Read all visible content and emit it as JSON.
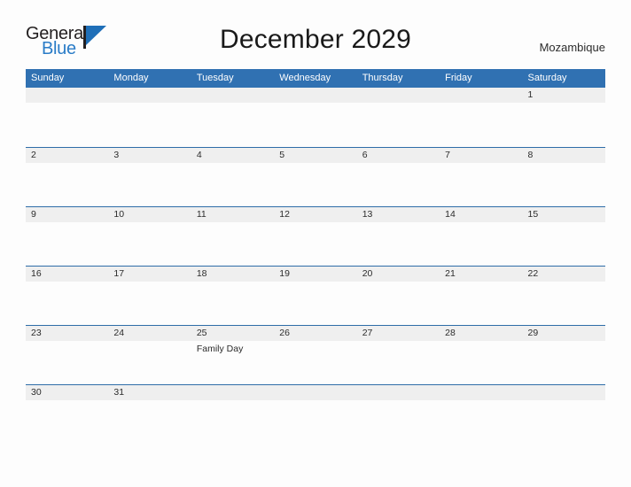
{
  "brand": {
    "name_part1": "General",
    "name_part2": "Blue",
    "mark": "pennant-triangle"
  },
  "header": {
    "title": "December 2029",
    "country": "Mozambique"
  },
  "colors": {
    "header_blue": "#3071b2",
    "row_border_blue": "#2e6da8",
    "date_band_gray": "#efefef",
    "brand_blue": "#2a7cc7",
    "text_dark": "#231f20"
  },
  "calendar": {
    "weekdays": [
      "Sunday",
      "Monday",
      "Tuesday",
      "Wednesday",
      "Thursday",
      "Friday",
      "Saturday"
    ],
    "weeks": [
      {
        "days": [
          {
            "num": "",
            "event": ""
          },
          {
            "num": "",
            "event": ""
          },
          {
            "num": "",
            "event": ""
          },
          {
            "num": "",
            "event": ""
          },
          {
            "num": "",
            "event": ""
          },
          {
            "num": "",
            "event": ""
          },
          {
            "num": "1",
            "event": ""
          }
        ]
      },
      {
        "days": [
          {
            "num": "2",
            "event": ""
          },
          {
            "num": "3",
            "event": ""
          },
          {
            "num": "4",
            "event": ""
          },
          {
            "num": "5",
            "event": ""
          },
          {
            "num": "6",
            "event": ""
          },
          {
            "num": "7",
            "event": ""
          },
          {
            "num": "8",
            "event": ""
          }
        ]
      },
      {
        "days": [
          {
            "num": "9",
            "event": ""
          },
          {
            "num": "10",
            "event": ""
          },
          {
            "num": "11",
            "event": ""
          },
          {
            "num": "12",
            "event": ""
          },
          {
            "num": "13",
            "event": ""
          },
          {
            "num": "14",
            "event": ""
          },
          {
            "num": "15",
            "event": ""
          }
        ]
      },
      {
        "days": [
          {
            "num": "16",
            "event": ""
          },
          {
            "num": "17",
            "event": ""
          },
          {
            "num": "18",
            "event": ""
          },
          {
            "num": "19",
            "event": ""
          },
          {
            "num": "20",
            "event": ""
          },
          {
            "num": "21",
            "event": ""
          },
          {
            "num": "22",
            "event": ""
          }
        ]
      },
      {
        "days": [
          {
            "num": "23",
            "event": ""
          },
          {
            "num": "24",
            "event": ""
          },
          {
            "num": "25",
            "event": "Family Day"
          },
          {
            "num": "26",
            "event": ""
          },
          {
            "num": "27",
            "event": ""
          },
          {
            "num": "28",
            "event": ""
          },
          {
            "num": "29",
            "event": ""
          }
        ]
      },
      {
        "days": [
          {
            "num": "30",
            "event": ""
          },
          {
            "num": "31",
            "event": ""
          },
          {
            "num": "",
            "event": ""
          },
          {
            "num": "",
            "event": ""
          },
          {
            "num": "",
            "event": ""
          },
          {
            "num": "",
            "event": ""
          },
          {
            "num": "",
            "event": ""
          }
        ]
      }
    ]
  }
}
